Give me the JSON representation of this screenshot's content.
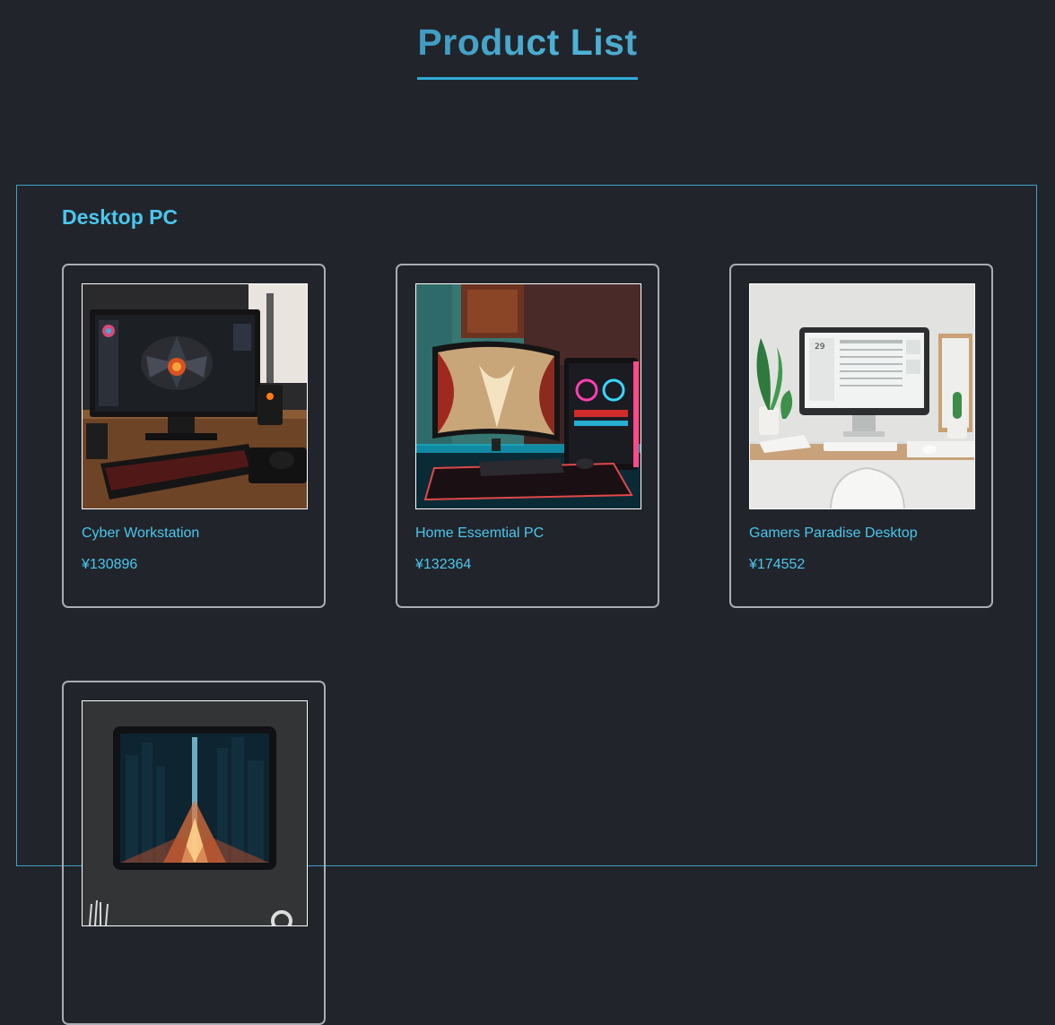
{
  "header": {
    "title": "Product List"
  },
  "section": {
    "title": "Desktop PC",
    "products": [
      {
        "name": "Cyber Workstation",
        "price": "¥130896",
        "image": "workstation-image"
      },
      {
        "name": "Home Essemtial PC",
        "price": "¥132364",
        "image": "gaming-setup-image"
      },
      {
        "name": "Gamers Paradise Desktop",
        "price": "¥174552",
        "image": "minimal-desk-image"
      },
      {
        "name": "",
        "price": "",
        "image": "cityscape-monitor-image"
      }
    ]
  },
  "colors": {
    "background": "#21252b",
    "accent": "#4cc6ee",
    "section_border": "#3aa2c8",
    "card_border": "#a9aeb4"
  }
}
